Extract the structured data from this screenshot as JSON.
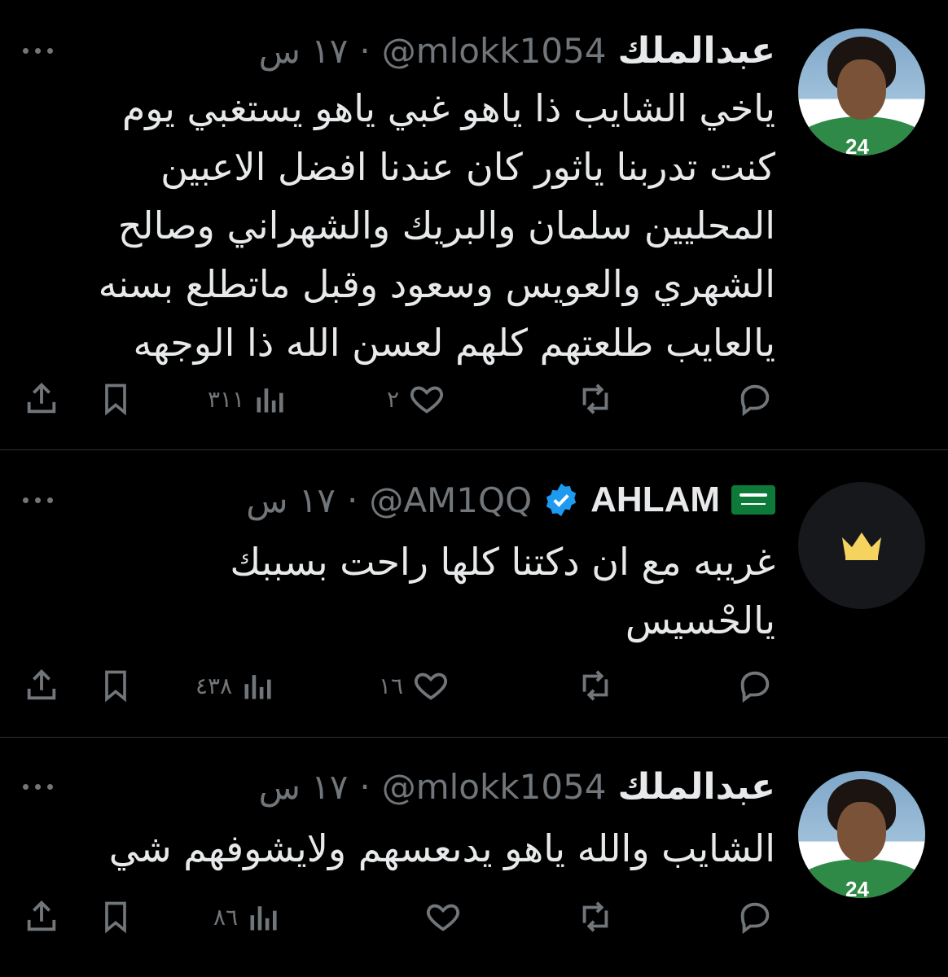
{
  "tweets": [
    {
      "name": "عبدالملك",
      "handle": "@mlokk1054",
      "time": "١٧ س",
      "lines": [
        "ياخي الشايب ذا ياهو غبي ياهو يستغبي يوم",
        "كنت تدربنا ياثور كان عندنا افضل الاعبين",
        "المحليين سلمان والبريك والشهراني وصالح",
        "الشهري والعويس وسعود وقبل ماتطلع بسنه",
        "يالعايب طلعتهم كلهم لعسن الله ذا الوجهه"
      ],
      "views": "٣١١",
      "likes": "٢",
      "avatar_shirt_number": "24"
    },
    {
      "name": "AHLAM",
      "handle": "@AM1QQ",
      "time": "١٧ س",
      "lines": [
        "غريبه مع ان دكتنا كلها راحت بسببك",
        "يالحْسيس"
      ],
      "views": "٤٣٨",
      "likes": "١٦"
    },
    {
      "name": "عبدالملك",
      "handle": "@mlokk1054",
      "time": "١٧ س",
      "lines": [
        "الشايب والله ياهو يدىعسهم ولايشوفهم شي"
      ],
      "views": "٨٦",
      "likes": "",
      "avatar_shirt_number": "24"
    }
  ],
  "separator": "·",
  "icons": {
    "reply": "reply-icon",
    "retweet": "retweet-icon",
    "like": "heart-icon",
    "views": "views-icon",
    "bookmark": "bookmark-icon",
    "share": "share-icon",
    "more": "more-icon",
    "verified": "verified-badge-icon",
    "flag": "saudi-flag-icon",
    "crown": "crown-icon"
  },
  "colors": {
    "background": "#000000",
    "text": "#e7e9ea",
    "muted": "#71767b",
    "verified": "#1d9bf0",
    "crown": "#f4d35e"
  }
}
